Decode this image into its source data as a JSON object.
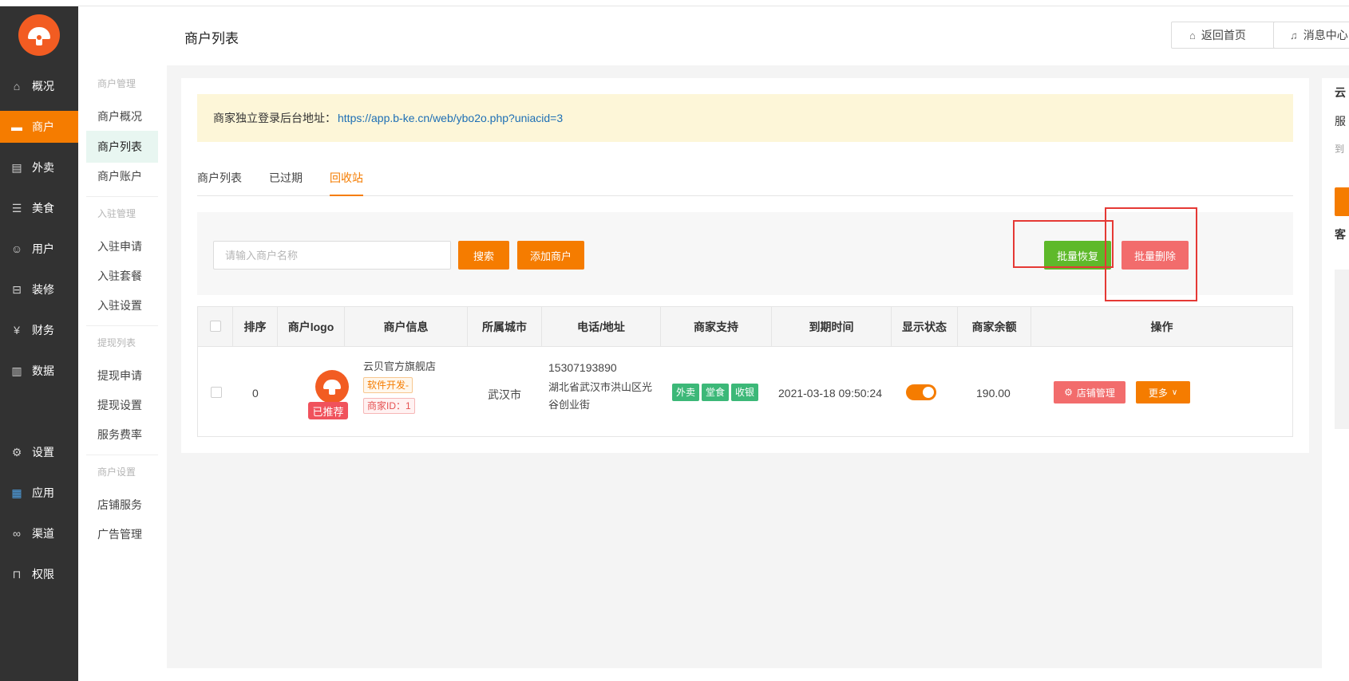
{
  "sidebar": {
    "items": [
      {
        "label": "概况",
        "icon": "home-icon",
        "glyph": "⌂"
      },
      {
        "label": "商户",
        "icon": "store-icon",
        "glyph": "▬"
      },
      {
        "label": "外卖",
        "icon": "document-icon",
        "glyph": "▤"
      },
      {
        "label": "美食",
        "icon": "menu-icon",
        "glyph": "☰"
      },
      {
        "label": "用户",
        "icon": "user-icon",
        "glyph": "☺"
      },
      {
        "label": "装修",
        "icon": "decorate-icon",
        "glyph": "⊟"
      },
      {
        "label": "财务",
        "icon": "finance-icon",
        "glyph": "¥"
      },
      {
        "label": "数据",
        "icon": "chart-icon",
        "glyph": "▥"
      },
      {
        "label": "设置",
        "icon": "gear-icon",
        "glyph": "⚙"
      },
      {
        "label": "应用",
        "icon": "apps-icon",
        "glyph": "▦"
      },
      {
        "label": "渠道",
        "icon": "link-icon",
        "glyph": "∞"
      },
      {
        "label": "权限",
        "icon": "lock-icon",
        "glyph": "⊓"
      }
    ]
  },
  "subnav": {
    "groups": [
      "商户管理",
      "入驻管理",
      "提现列表",
      "商户设置"
    ],
    "items": [
      "商户概况",
      "商户列表",
      "商户账户",
      "入驻申请",
      "入驻套餐",
      "入驻设置",
      "提现申请",
      "提现设置",
      "服务费率",
      "店铺服务",
      "广告管理"
    ]
  },
  "header": {
    "title": "商户列表",
    "home_button": "返回首页",
    "message_button": "消息中心"
  },
  "notice": {
    "label": "商家独立登录后台地址：",
    "url": "https://app.b-ke.cn/web/ybo2o.php?uniacid=3"
  },
  "tabs": [
    "商户列表",
    "已过期",
    "回收站"
  ],
  "toolbar": {
    "search_placeholder": "请输入商户名称",
    "search_button": "搜索",
    "add_button": "添加商户",
    "batch_restore": "批量恢复",
    "batch_delete": "批量删除"
  },
  "table": {
    "headers": [
      "排序",
      "商户logo",
      "商户信息",
      "所属城市",
      "电话/地址",
      "商家支持",
      "到期时间",
      "显示状态",
      "商家余额",
      "操作"
    ],
    "rows": [
      {
        "sort": "0",
        "badge": "已推荐",
        "name": "云贝官方旗舰店",
        "category": "软件开发-",
        "merchant_id": "商家ID：1",
        "city": "武汉市",
        "phone": "15307193890",
        "address_line1": "湖北省武汉市洪山区光",
        "address_line2": "谷创业街",
        "support": [
          "外卖",
          "堂食",
          "收银"
        ],
        "expire": "2021-03-18 09:50:24",
        "display_on": true,
        "balance": "190.00",
        "manage_button": "店铺管理",
        "more_button": "更多"
      }
    ]
  },
  "right_panel": {
    "lines": [
      "云",
      "服",
      "到",
      "客"
    ]
  },
  "colors": {
    "accent": "#f57c00",
    "sidebar_bg": "#323232",
    "success": "#5eb92a",
    "danger": "#f26c6c",
    "highlight_box": "#e53935"
  }
}
